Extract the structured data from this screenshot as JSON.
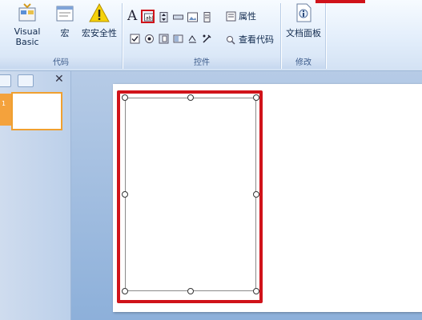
{
  "ribbon": {
    "code_group": {
      "label": "代码",
      "visual_basic": "Visual Basic",
      "macro": "宏",
      "macro_security": "宏安全性"
    },
    "controls_group": {
      "label": "控件",
      "label_control": "A",
      "properties": "属性",
      "view_code": "查看代码"
    },
    "modify_group": {
      "label": "修改",
      "document_panel": "文档面板"
    }
  },
  "pane": {
    "close": "✕",
    "slide_number": "1"
  },
  "colors": {
    "highlight": "#d0131a",
    "accent": "#f0a030"
  }
}
